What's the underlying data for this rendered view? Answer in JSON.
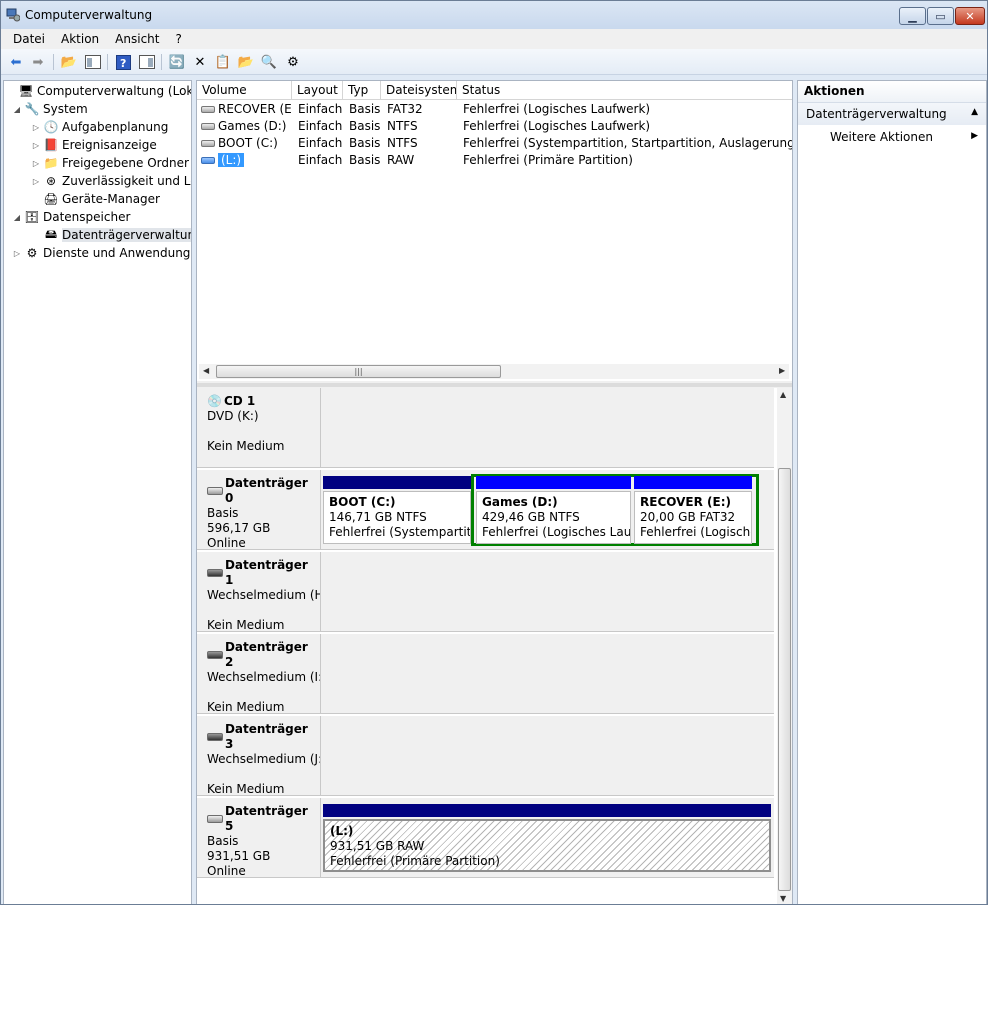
{
  "window": {
    "title": "Computerverwaltung"
  },
  "menu": [
    "Datei",
    "Aktion",
    "Ansicht",
    "?"
  ],
  "tree": [
    {
      "label": "Computerverwaltung (Lokal)",
      "icon": "computer-management-icon",
      "glyph": "🖥",
      "expander": ""
    },
    {
      "label": "System",
      "icon": "tools-icon",
      "glyph": "🔧",
      "expander": "◢"
    },
    {
      "label": "Aufgabenplanung",
      "icon": "clock-icon",
      "glyph": "🕓",
      "expander": "▷"
    },
    {
      "label": "Ereignisanzeige",
      "icon": "event-viewer-icon",
      "glyph": "📕",
      "expander": "▷"
    },
    {
      "label": "Freigegebene Ordner",
      "icon": "shared-folder-icon",
      "glyph": "📁",
      "expander": "▷"
    },
    {
      "label": "Zuverlässigkeit und Leis",
      "icon": "performance-icon",
      "glyph": "⊛",
      "expander": "▷"
    },
    {
      "label": "Geräte-Manager",
      "icon": "device-manager-icon",
      "glyph": "🖨",
      "expander": ""
    },
    {
      "label": "Datenspeicher",
      "icon": "storage-icon",
      "glyph": "🗄",
      "expander": "◢"
    },
    {
      "label": "Datenträgerverwaltung",
      "icon": "disk-management-icon",
      "glyph": "🖴",
      "expander": ""
    },
    {
      "label": "Dienste und Anwendungen",
      "icon": "services-icon",
      "glyph": "⚙",
      "expander": "▷"
    }
  ],
  "volumes": {
    "columns": [
      "Volume",
      "Layout",
      "Typ",
      "Dateisystem",
      "Status"
    ],
    "rows": [
      {
        "volume": "RECOVER (E:)",
        "layout": "Einfach",
        "typ": "Basis",
        "fs": "FAT32",
        "status": "Fehlerfrei (Logisches Laufwerk)"
      },
      {
        "volume": "Games (D:)",
        "layout": "Einfach",
        "typ": "Basis",
        "fs": "NTFS",
        "status": "Fehlerfrei (Logisches Laufwerk)"
      },
      {
        "volume": "BOOT (C:)",
        "layout": "Einfach",
        "typ": "Basis",
        "fs": "NTFS",
        "status": "Fehlerfrei (Systempartition, Startpartition, Auslagerungsdatei, A"
      },
      {
        "volume": "(L:)",
        "layout": "Einfach",
        "typ": "Basis",
        "fs": "RAW",
        "status": "Fehlerfrei (Primäre Partition)"
      }
    ]
  },
  "disks": [
    {
      "name": "CD 1",
      "line1": "DVD (K:)",
      "line2": "",
      "line3": "Kein Medium"
    },
    {
      "name": "Datenträger 0",
      "line1": "Basis",
      "line2": "596,17 GB",
      "line3": "Online"
    },
    {
      "name": "Datenträger 1",
      "line1": "Wechselmedium (H",
      "line2": "",
      "line3": "Kein Medium"
    },
    {
      "name": "Datenträger 2",
      "line1": "Wechselmedium (I:)",
      "line2": "",
      "line3": "Kein Medium"
    },
    {
      "name": "Datenträger 3",
      "line1": "Wechselmedium (J:)",
      "line2": "",
      "line3": "Kein Medium"
    },
    {
      "name": "Datenträger 5",
      "line1": "Basis",
      "line2": "931,51 GB",
      "line3": "Online"
    }
  ],
  "partitions": {
    "boot": {
      "name": "BOOT  (C:)",
      "size": "146,71 GB NTFS",
      "status": "Fehlerfrei (Systempartitio"
    },
    "games": {
      "name": "Games  (D:)",
      "size": "429,46 GB NTFS",
      "status": "Fehlerfrei (Logisches Laufw"
    },
    "recover": {
      "name": "RECOVER  (E:)",
      "size": "20,00 GB FAT32",
      "status": "Fehlerfrei (Logisches"
    },
    "l": {
      "name": "(L:)",
      "size": "931,51 GB RAW",
      "status": "Fehlerfrei (Primäre Partition)"
    }
  },
  "actions": {
    "header": "Aktionen",
    "section": "Datenträgerverwaltung",
    "item": "Weitere Aktionen"
  },
  "colors": {
    "primary_bar": "#000080",
    "logical_bar": "#0000ff",
    "extended_border": "#008000",
    "selection": "#3399ff"
  }
}
